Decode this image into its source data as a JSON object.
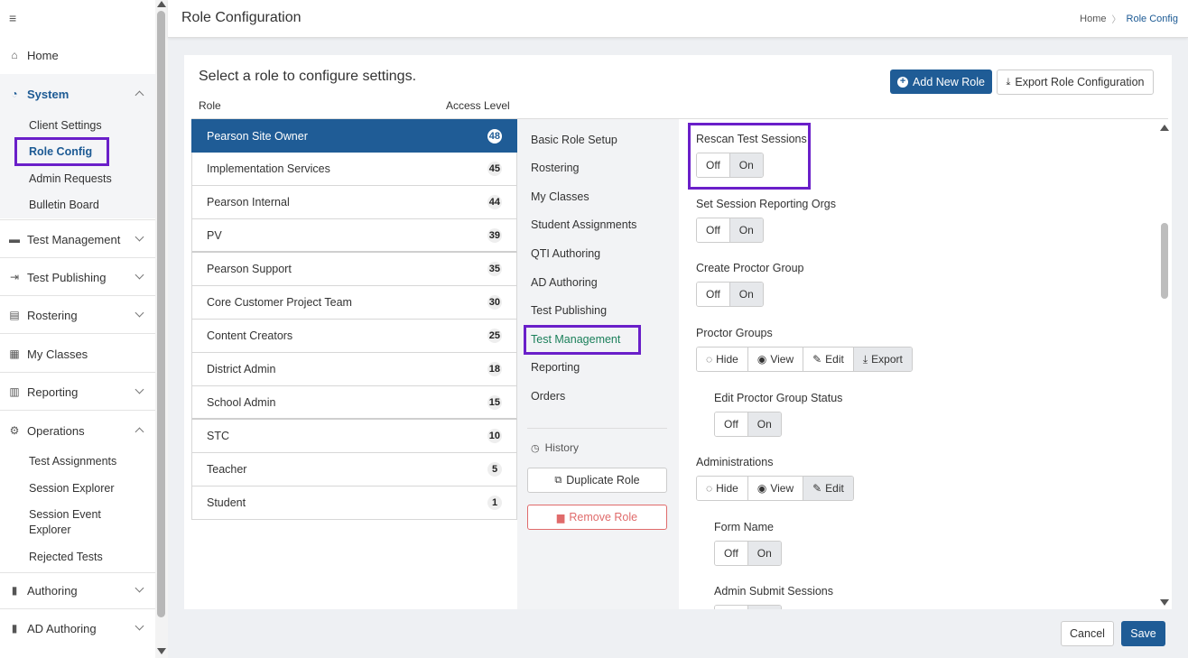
{
  "sidebar": {
    "menu_glyph": "≡",
    "items": [
      {
        "label": "Home",
        "icon": "home-icon"
      },
      {
        "label": "System",
        "icon": "dashboard-icon"
      },
      {
        "label": "Test Management",
        "icon": "folder-icon"
      },
      {
        "label": "Test Publishing",
        "icon": "publish-icon"
      },
      {
        "label": "Rostering",
        "icon": "clipboard-icon"
      },
      {
        "label": "My Classes",
        "icon": "classes-icon"
      },
      {
        "label": "Reporting",
        "icon": "bar-chart-icon"
      },
      {
        "label": "Operations",
        "icon": "cogs-icon"
      },
      {
        "label": "Authoring",
        "icon": "book-icon"
      },
      {
        "label": "AD Authoring",
        "icon": "book-icon"
      }
    ],
    "system_sub": [
      "Client Settings",
      "Role Config",
      "Admin Requests",
      "Bulletin Board"
    ],
    "operations_sub": [
      "Test Assignments",
      "Session Explorer",
      "Session Event Explorer",
      "Rejected Tests"
    ]
  },
  "header": {
    "title": "Role Configuration",
    "breadcrumb": {
      "home": "Home",
      "current": "Role Config"
    }
  },
  "card": {
    "prompt": "Select a role to configure settings.",
    "add_role_label": "Add New Role",
    "export_label": "Export Role Configuration",
    "col_role": "Role",
    "col_access": "Access Level"
  },
  "roles": [
    {
      "name": "Pearson Site Owner",
      "level": "48"
    },
    {
      "name": "Implementation Services",
      "level": "45"
    },
    {
      "name": "Pearson Internal",
      "level": "44"
    },
    {
      "name": "PV",
      "level": "39"
    },
    {
      "name": "Pearson Support",
      "level": "35"
    },
    {
      "name": "Core Customer Project Team",
      "level": "30"
    },
    {
      "name": "Content Creators",
      "level": "25"
    },
    {
      "name": "District Admin",
      "level": "18"
    },
    {
      "name": "School Admin",
      "level": "15"
    },
    {
      "name": "STC",
      "level": "10"
    },
    {
      "name": "Teacher",
      "level": "5"
    },
    {
      "name": "Student",
      "level": "1"
    }
  ],
  "mid_menu": {
    "items": [
      "Basic Role Setup",
      "Rostering",
      "My Classes",
      "Student Assignments",
      "QTI Authoring",
      "AD Authoring",
      "Test Publishing",
      "Test Management",
      "Reporting",
      "Orders"
    ],
    "history_label": "History",
    "duplicate_label": "Duplicate Role",
    "remove_label": "Remove Role"
  },
  "settings": {
    "rescan": "Rescan Test Sessions",
    "reporting_orgs": "Set Session Reporting Orgs",
    "create_proctor": "Create Proctor Group",
    "proctor_groups": "Proctor Groups",
    "edit_proctor_status": "Edit Proctor Group Status",
    "administrations": "Administrations",
    "form_name": "Form Name",
    "admin_submit": "Admin Submit Sessions",
    "off": "Off",
    "on": "On",
    "hide": "Hide",
    "view": "View",
    "edit": "Edit",
    "export": "Export"
  },
  "footer": {
    "cancel": "Cancel",
    "save": "Save"
  },
  "colors": {
    "primary": "#1f5c96",
    "highlight": "#6a1fc9",
    "active_green": "#1a7f5a",
    "danger": "#e06b6b"
  }
}
